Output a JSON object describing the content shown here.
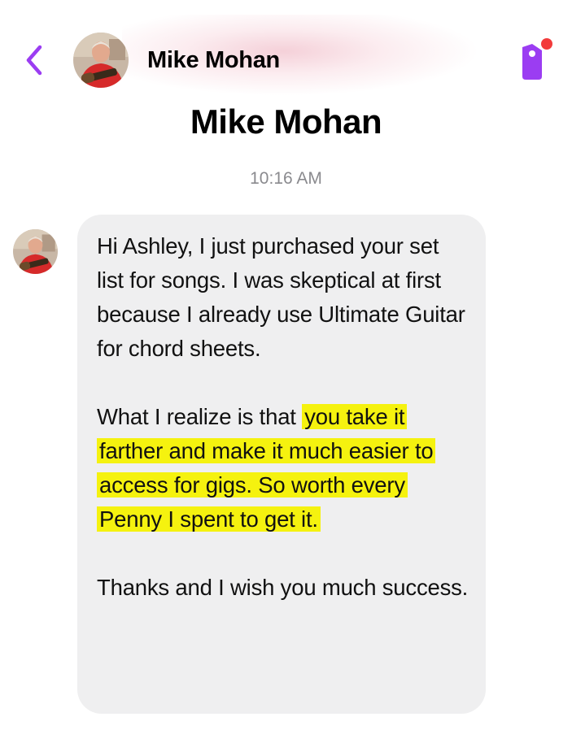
{
  "header": {
    "contact_name": "Mike Mohan",
    "back_icon": "chevron-left-icon",
    "tag_icon": "tag-icon",
    "accent_color": "#9b3df2",
    "notification_dot_color": "#f23b3b"
  },
  "conversation": {
    "title": "Mike Mohan",
    "timestamp": "10:16 AM"
  },
  "message": {
    "para1": "Hi Ashley, I just purchased your set list for songs.  I was skeptical at first because I already use Ultimate Guitar for chord sheets.",
    "para2_plain": "What I realize is that",
    "para2_highlight": "you take it farther and make it much easier to access for gigs.  So worth every Penny I spent to get it.",
    "para3": "Thanks and I wish you much success.",
    "highlight_color": "#f5f20f",
    "bubble_color": "#efeff0"
  }
}
